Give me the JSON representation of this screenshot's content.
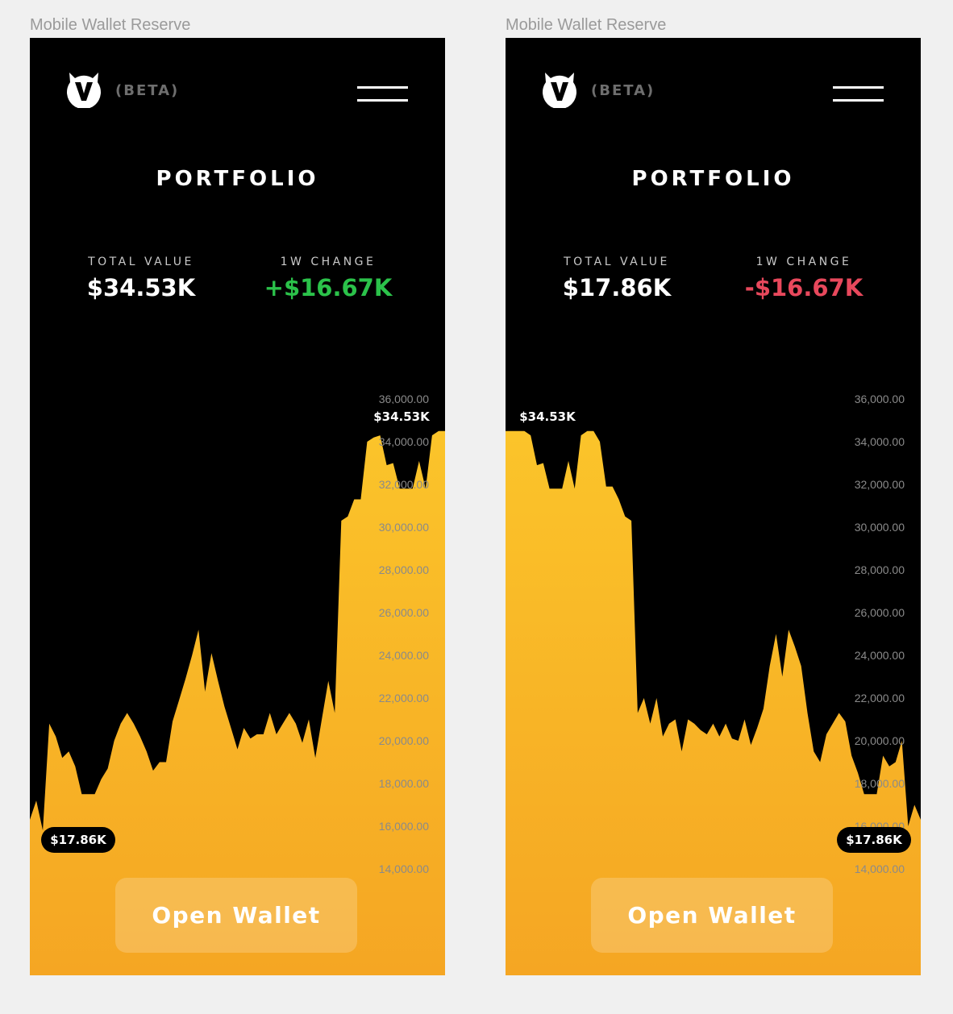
{
  "accent_color": "#f8b41e",
  "positive_color": "#2bc24a",
  "negative_color": "#e8485c",
  "screens": [
    {
      "frame_label": "Mobile Wallet Reserve",
      "logo_icon": "fox-head-logo",
      "beta": "(BETA)",
      "menu_icon": "hamburger-menu-icon",
      "title": "PORTFOLIO",
      "total_value_label": "TOTAL VALUE",
      "total_value": "$34.53K",
      "change_label": "1W CHANGE",
      "change_value": "+$16.67K",
      "change_direction": "up",
      "start_marker": "$17.86K",
      "end_marker": "$34.53K",
      "button_label": "Open Wallet"
    },
    {
      "frame_label": "Mobile Wallet Reserve",
      "logo_icon": "fox-head-logo",
      "beta": "(BETA)",
      "menu_icon": "hamburger-menu-icon",
      "title": "PORTFOLIO",
      "total_value_label": "TOTAL VALUE",
      "total_value": "$17.86K",
      "change_label": "1W CHANGE",
      "change_value": "-$16.67K",
      "change_direction": "down",
      "start_marker": "$34.53K",
      "end_marker": "$17.86K",
      "button_label": "Open Wallet"
    }
  ],
  "chart_data": [
    {
      "type": "area",
      "series": [
        {
          "values": [
            16300,
            17200,
            15800,
            20800,
            20200,
            19200,
            19500,
            18800,
            17500,
            17500,
            17500,
            18200,
            18700,
            20000,
            20800,
            21300,
            20800,
            20200,
            19500,
            18600,
            19000,
            19000,
            20900,
            21900,
            22900,
            24000,
            25200,
            22300,
            24100,
            22800,
            21600,
            20600,
            19600,
            20600,
            20100,
            20300,
            20300,
            21300,
            20300,
            20800,
            21300,
            20800,
            19900,
            21000,
            19200,
            21000,
            22800,
            21300,
            30300,
            30500,
            31300,
            31300,
            34000,
            34200,
            34300,
            32900,
            33000,
            31800,
            31800,
            31800,
            33100,
            31800,
            34300,
            34500,
            34500
          ]
        }
      ],
      "ylim": [
        13000,
        36500
      ],
      "y_ticks": [
        "36,000.00",
        "34,000.00",
        "32,000.00",
        "30,000.00",
        "28,000.00",
        "26,000.00",
        "24,000.00",
        "22,000.00",
        "20,000.00",
        "18,000.00",
        "16,000.00",
        "14,000.00"
      ],
      "grid": false
    },
    {
      "type": "area",
      "series": [
        {
          "values": [
            34500,
            34500,
            34500,
            34500,
            34300,
            32900,
            33000,
            31800,
            31800,
            31800,
            33100,
            31800,
            34300,
            34500,
            34500,
            34000,
            31900,
            31900,
            31300,
            30500,
            30300,
            21300,
            22000,
            20800,
            22000,
            20200,
            20800,
            21000,
            19500,
            21000,
            20800,
            20500,
            20300,
            20800,
            20200,
            20800,
            20100,
            20000,
            21000,
            19800,
            20600,
            21500,
            23500,
            25000,
            23000,
            25200,
            24400,
            23500,
            21300,
            19500,
            19000,
            20300,
            20800,
            21300,
            20900,
            19300,
            18500,
            17500,
            17500,
            17500,
            19300,
            18800,
            19000,
            20000,
            16000,
            17000,
            16300
          ]
        }
      ],
      "ylim": [
        13000,
        36500
      ],
      "y_ticks": [
        "36,000.00",
        "34,000.00",
        "32,000.00",
        "30,000.00",
        "28,000.00",
        "26,000.00",
        "24,000.00",
        "22,000.00",
        "20,000.00",
        "18,000.00",
        "16,000.00",
        "14,000.00"
      ],
      "grid": false
    }
  ]
}
